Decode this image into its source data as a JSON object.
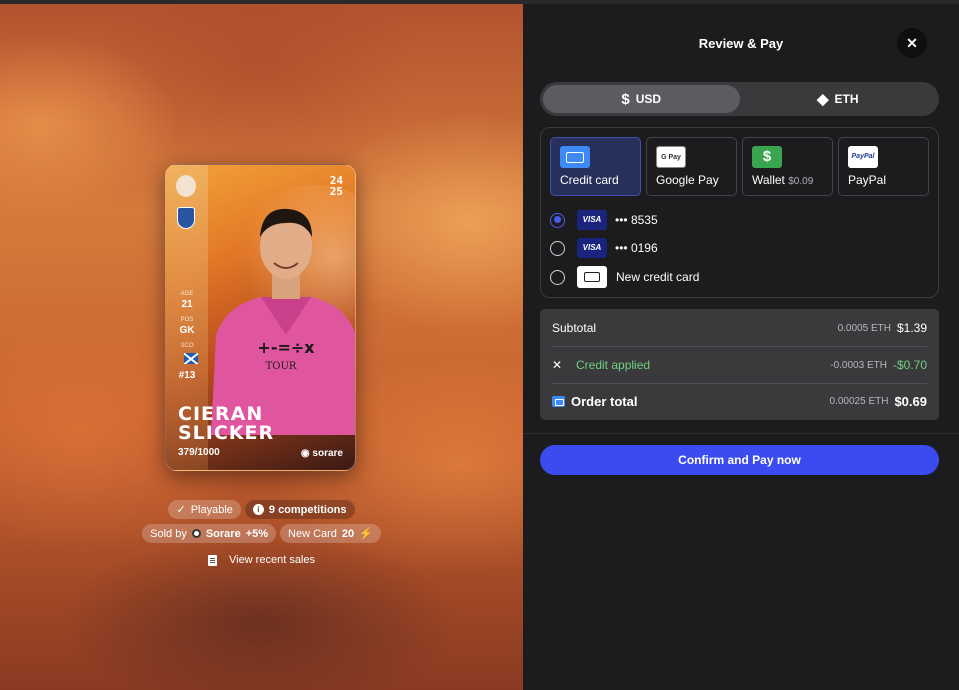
{
  "card": {
    "season_top": "24",
    "season_bottom": "25",
    "age_label": "AGE",
    "age_value": "21",
    "pos_label": "POS",
    "pos_value": "GK",
    "nat_label": "SCO",
    "number": "#13",
    "first_name": "CIERAN",
    "last_name": "SLICKER",
    "serial": "379/1000",
    "brand": "sorare"
  },
  "badges": {
    "playable": "Playable",
    "competitions": "9 competitions",
    "sold_by_label": "Sold by",
    "seller": "Sorare",
    "fee": "+5%",
    "new_card": "New Card",
    "level": "20",
    "view_sales": "View recent sales"
  },
  "panel": {
    "title": "Review & Pay",
    "close_icon": "close-icon",
    "currency_tabs": [
      {
        "symbol": "$",
        "label": "USD",
        "active": true
      },
      {
        "symbol": "◆",
        "label": "ETH",
        "active": false
      }
    ],
    "methods": [
      {
        "label": "Credit card",
        "icon": "credit-card-icon",
        "active": true
      },
      {
        "label": "Google Pay",
        "icon": "google-pay-icon",
        "icon_text": "G Pay",
        "active": false
      },
      {
        "label": "Wallet",
        "sub": "$0.09",
        "icon": "wallet-dollar-icon",
        "icon_text": "$",
        "active": false
      },
      {
        "label": "PayPal",
        "icon": "paypal-icon",
        "icon_text": "PayPal",
        "active": false
      }
    ],
    "cards": [
      {
        "brand": "VISA",
        "masked": "••• 8535",
        "selected": true
      },
      {
        "brand": "VISA",
        "masked": "••• 0196",
        "selected": false
      }
    ],
    "new_card": "New credit card",
    "summary": {
      "subtotal_label": "Subtotal",
      "subtotal_eth": "0.0005 ETH",
      "subtotal_usd": "$1.39",
      "credit_label": "Credit applied",
      "credit_eth": "-0.0003 ETH",
      "credit_usd": "-$0.70",
      "total_label": "Order total",
      "total_eth": "0.00025 ETH",
      "total_usd": "$0.69"
    },
    "confirm": "Confirm and Pay now",
    "accent": "#3b4bf0",
    "credit_color": "#6fcf7f"
  }
}
